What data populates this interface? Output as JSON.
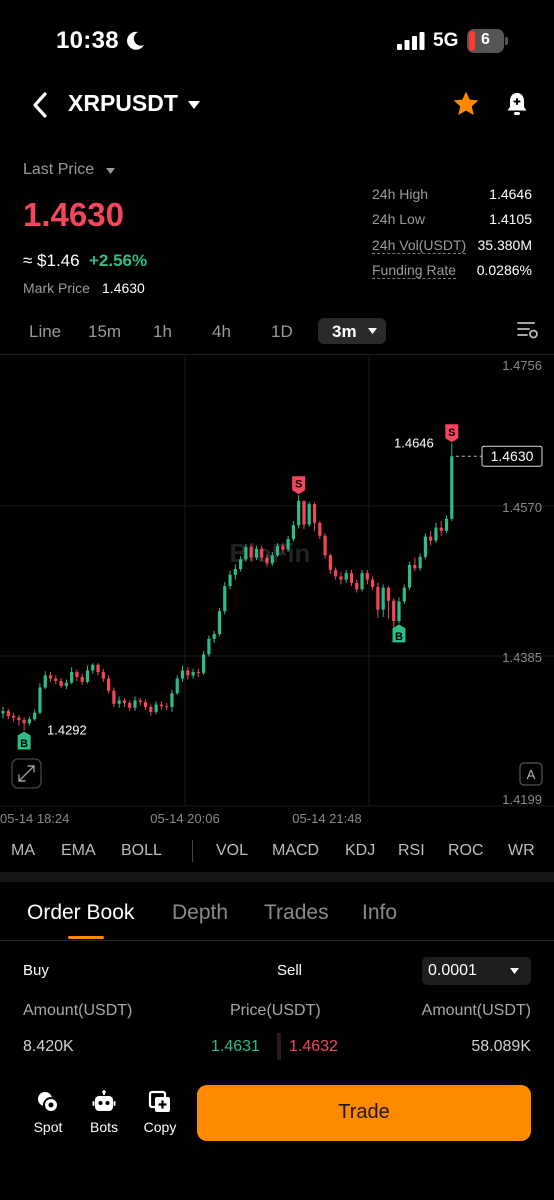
{
  "status_bar": {
    "time": "10:38",
    "network": "5G",
    "battery": "6"
  },
  "header": {
    "pair": "XRPUSDT"
  },
  "price": {
    "last_price_label": "Last Price",
    "last_price": "1.4630",
    "approx_usd": "≈ $1.46",
    "change": "+2.56%",
    "mark_label": "Mark Price",
    "mark_value": "1.4630",
    "stats": [
      {
        "label": "24h High",
        "value": "1.4646"
      },
      {
        "label": "24h Low",
        "value": "1.4105"
      },
      {
        "label": "24h Vol(USDT)",
        "value": "35.380M"
      },
      {
        "label": "Funding Rate",
        "value": "0.0286%"
      }
    ]
  },
  "intervals": {
    "items": [
      "Line",
      "15m",
      "1h",
      "4h",
      "1D"
    ],
    "active": "3m"
  },
  "chart_data": {
    "type": "candlestick",
    "y_ticks": [
      "1.4756",
      "1.4570",
      "1.4385",
      "1.4199"
    ],
    "ylim": [
      1.4199,
      1.4756
    ],
    "x_ticks": [
      "05-14 18:24",
      "05-14 20:06",
      "05-14 21:48"
    ],
    "high_label": "1.4646",
    "low_label": "1.4292",
    "current_price": "1.4630",
    "watermark": "BloFin",
    "candles": [
      [
        1.4313,
        1.4316,
        1.4321,
        1.4307
      ],
      [
        1.4316,
        1.431,
        1.4319,
        1.4306
      ],
      [
        1.431,
        1.4308,
        1.4314,
        1.4303
      ],
      [
        1.4308,
        1.4305,
        1.4311,
        1.4298
      ],
      [
        1.4305,
        1.4301,
        1.4308,
        1.4292
      ],
      [
        1.4301,
        1.4306,
        1.4309,
        1.4298
      ],
      [
        1.4306,
        1.4314,
        1.4318,
        1.4304
      ],
      [
        1.4314,
        1.4345,
        1.435,
        1.4312
      ],
      [
        1.4345,
        1.436,
        1.4365,
        1.4343
      ],
      [
        1.436,
        1.4356,
        1.4364,
        1.4352
      ],
      [
        1.4356,
        1.4353,
        1.436,
        1.4349
      ],
      [
        1.4353,
        1.4347,
        1.4357,
        1.4344
      ],
      [
        1.4347,
        1.4351,
        1.4355,
        1.4343
      ],
      [
        1.4351,
        1.4364,
        1.437,
        1.4349
      ],
      [
        1.4364,
        1.4358,
        1.4367,
        1.4353
      ],
      [
        1.4358,
        1.4352,
        1.4362,
        1.4348
      ],
      [
        1.4352,
        1.4366,
        1.4372,
        1.435
      ],
      [
        1.4366,
        1.4373,
        1.4375,
        1.4362
      ],
      [
        1.4373,
        1.4364,
        1.4375,
        1.436
      ],
      [
        1.4364,
        1.4356,
        1.4368,
        1.4352
      ],
      [
        1.4356,
        1.4341,
        1.436,
        1.4338
      ],
      [
        1.4341,
        1.4325,
        1.4345,
        1.4321
      ],
      [
        1.4325,
        1.4329,
        1.4334,
        1.432
      ],
      [
        1.4329,
        1.4326,
        1.4332,
        1.4321
      ],
      [
        1.4326,
        1.432,
        1.4329,
        1.4316
      ],
      [
        1.432,
        1.4329,
        1.4334,
        1.4316
      ],
      [
        1.4329,
        1.4327,
        1.4332,
        1.4323
      ],
      [
        1.4327,
        1.4321,
        1.433,
        1.4317
      ],
      [
        1.4321,
        1.4315,
        1.4324,
        1.431
      ],
      [
        1.4315,
        1.4324,
        1.4328,
        1.4312
      ],
      [
        1.4324,
        1.4322,
        1.4328,
        1.4318
      ],
      [
        1.4322,
        1.4321,
        1.4326,
        1.4317
      ],
      [
        1.4321,
        1.4338,
        1.4342,
        1.4315
      ],
      [
        1.4338,
        1.4356,
        1.436,
        1.4336
      ],
      [
        1.4356,
        1.4366,
        1.4372,
        1.4352
      ],
      [
        1.4366,
        1.436,
        1.437,
        1.4355
      ],
      [
        1.436,
        1.4364,
        1.4368,
        1.4356
      ],
      [
        1.4364,
        1.4363,
        1.4368,
        1.4358
      ],
      [
        1.4363,
        1.4386,
        1.439,
        1.436
      ],
      [
        1.4386,
        1.4405,
        1.4409,
        1.4383
      ],
      [
        1.4405,
        1.4411,
        1.4415,
        1.44
      ],
      [
        1.4411,
        1.4439,
        1.4443,
        1.4408
      ],
      [
        1.4439,
        1.447,
        1.4475,
        1.4435
      ],
      [
        1.447,
        1.4484,
        1.4489,
        1.4466
      ],
      [
        1.4484,
        1.4491,
        1.4497,
        1.4478
      ],
      [
        1.4491,
        1.4503,
        1.4507,
        1.4488
      ],
      [
        1.4503,
        1.4518,
        1.4522,
        1.45
      ],
      [
        1.4518,
        1.4505,
        1.4521,
        1.4501
      ],
      [
        1.4505,
        1.4516,
        1.452,
        1.4502
      ],
      [
        1.4516,
        1.4505,
        1.452,
        1.4501
      ],
      [
        1.4505,
        1.4498,
        1.4509,
        1.4494
      ],
      [
        1.4498,
        1.4508,
        1.4512,
        1.4495
      ],
      [
        1.4508,
        1.4519,
        1.4523,
        1.4506
      ],
      [
        1.4519,
        1.4515,
        1.4523,
        1.4511
      ],
      [
        1.4515,
        1.4528,
        1.4532,
        1.4512
      ],
      [
        1.4528,
        1.4545,
        1.455,
        1.4525
      ],
      [
        1.4545,
        1.4575,
        1.4582,
        1.4541
      ],
      [
        1.4575,
        1.4546,
        1.4575,
        1.454
      ],
      [
        1.4546,
        1.4571,
        1.4574,
        1.4543
      ],
      [
        1.4571,
        1.4548,
        1.4573,
        1.4538
      ],
      [
        1.4548,
        1.4532,
        1.455,
        1.4528
      ],
      [
        1.4532,
        1.4508,
        1.4535,
        1.4504
      ],
      [
        1.4508,
        1.449,
        1.451,
        1.4485
      ],
      [
        1.449,
        1.4482,
        1.4493,
        1.4478
      ],
      [
        1.4482,
        1.4478,
        1.4487,
        1.4472
      ],
      [
        1.4478,
        1.4486,
        1.449,
        1.4474
      ],
      [
        1.4486,
        1.4474,
        1.449,
        1.447
      ],
      [
        1.4474,
        1.4466,
        1.4478,
        1.4462
      ],
      [
        1.4466,
        1.4486,
        1.449,
        1.4463
      ],
      [
        1.4486,
        1.4478,
        1.449,
        1.4472
      ],
      [
        1.4478,
        1.4469,
        1.4482,
        1.4465
      ],
      [
        1.4469,
        1.4441,
        1.4474,
        1.4431
      ],
      [
        1.4441,
        1.4468,
        1.4472,
        1.4432
      ],
      [
        1.4468,
        1.4452,
        1.447,
        1.443
      ],
      [
        1.4452,
        1.4427,
        1.4455,
        1.4419
      ],
      [
        1.4427,
        1.4451,
        1.4456,
        1.4424
      ],
      [
        1.4451,
        1.4468,
        1.4472,
        1.4448
      ],
      [
        1.4468,
        1.4496,
        1.45,
        1.4465
      ],
      [
        1.4496,
        1.4492,
        1.4505,
        1.4488
      ],
      [
        1.4492,
        1.4506,
        1.451,
        1.4489
      ],
      [
        1.4506,
        1.4531,
        1.4535,
        1.4503
      ],
      [
        1.4531,
        1.4526,
        1.4538,
        1.452
      ],
      [
        1.4526,
        1.4542,
        1.4548,
        1.4523
      ],
      [
        1.4542,
        1.4538,
        1.455,
        1.4532
      ],
      [
        1.4538,
        1.4553,
        1.4557,
        1.4535
      ],
      [
        1.4553,
        1.463,
        1.4646,
        1.455
      ]
    ],
    "markers": [
      {
        "label": "B",
        "candle": 4,
        "type": "buy"
      },
      {
        "label": "S",
        "candle": 56,
        "type": "sell"
      },
      {
        "label": "B",
        "candle": 75,
        "type": "buy"
      },
      {
        "label": "S",
        "candle": 85,
        "type": "sell"
      }
    ],
    "expand_icon": "expand-icon",
    "auto_button": "A"
  },
  "indicators": [
    "MA",
    "EMA",
    "BOLL",
    "VOL",
    "MACD",
    "KDJ",
    "RSI",
    "ROC",
    "WR"
  ],
  "tabs": [
    "Order Book",
    "Depth",
    "Trades",
    "Info"
  ],
  "order_book": {
    "buy_label": "Buy",
    "sell_label": "Sell",
    "precision": "0.0001",
    "headers": [
      "Amount(USDT)",
      "Price(USDT)",
      "Amount(USDT)"
    ],
    "bid_amount": "8.420K",
    "bid_price": "1.4631",
    "ask_price": "1.4632",
    "ask_amount": "58.089K"
  },
  "bottom_nav": {
    "items": [
      {
        "label": "Spot",
        "icon": "spot-icon"
      },
      {
        "label": "Bots",
        "icon": "bot-icon"
      },
      {
        "label": "Copy",
        "icon": "copy-icon"
      }
    ],
    "trade_label": "Trade"
  },
  "colors": {
    "up": "#2ebd85",
    "down": "#f6465d",
    "accent": "#ff8a00"
  }
}
